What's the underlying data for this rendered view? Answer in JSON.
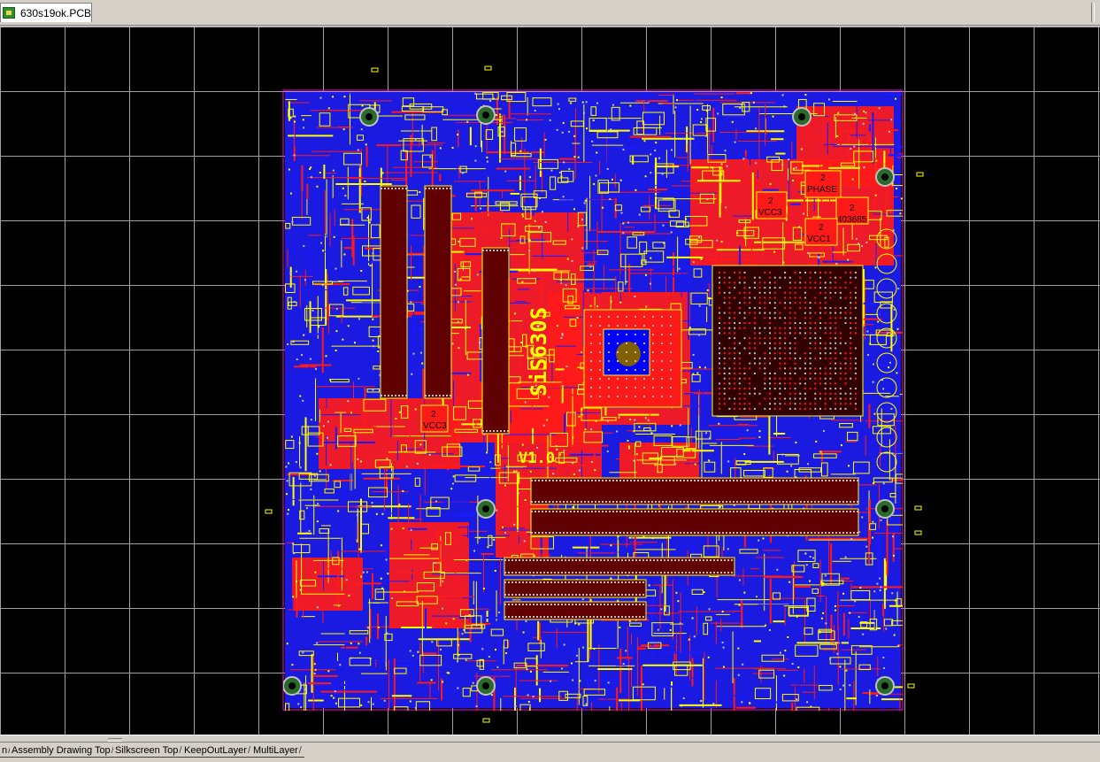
{
  "document_tab": {
    "label": "630s19ok.PCB"
  },
  "board": {
    "silk_board_name": "SiS630S",
    "silk_version": "V1.0",
    "net_labels": [
      {
        "num": "2",
        "text": "VCC3"
      },
      {
        "num": "2",
        "text": "PHASE"
      },
      {
        "num": "2",
        "text": "403685"
      },
      {
        "num": "2",
        "text": "VCC1"
      },
      {
        "num": "2",
        "text": "VCC3"
      }
    ]
  },
  "layer_tabs": [
    {
      "label": "n"
    },
    {
      "label": "Assembly Drawing Top"
    },
    {
      "label": "Silkscreen Top"
    },
    {
      "label": "KeepOutLayer"
    },
    {
      "label": "MultiLayer"
    }
  ],
  "colors": {
    "canvas_bg": "#000000",
    "grid": "#a0a0a0",
    "top_copper": "#ff1a1a",
    "bottom_copper": "#1a1aff",
    "silkscreen": "#ffff00",
    "keepout": "#ff00ff",
    "pad": "#c0c0c0"
  }
}
